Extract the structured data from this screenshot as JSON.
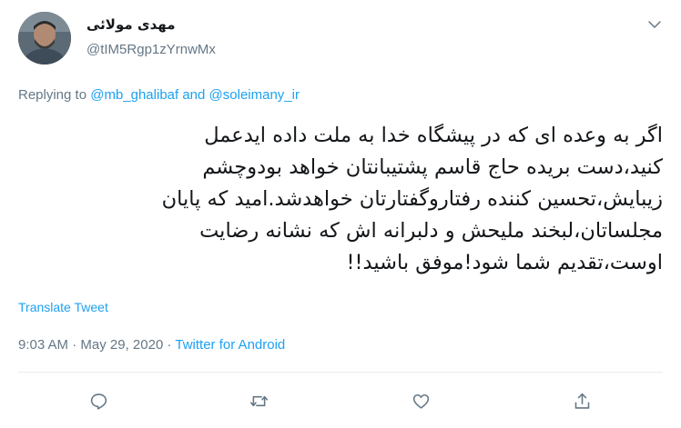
{
  "author": {
    "name": "مهدی مولائی",
    "handle": "@tIM5Rgp1zYrnwMx"
  },
  "reply": {
    "prefix": "Replying to",
    "mention_1": "@mb_ghalibaf",
    "conjunction": "and",
    "mention_2": "@soleimany_ir"
  },
  "tweet": {
    "lines": [
      "اگر به وعده ای که در پیشگاه خدا به ملت داده ایدعمل",
      "کنید،دست بریده حاج قاسم پشتیبانتان خواهد بودوچشم",
      "زیبایش،تحسین کننده رفتاروگفتارتان خواهدشد.امید که پایان",
      "مجلساتان،لبخند ملیحش و دلبرانه اش که نشانه رضایت",
      "اوست،تقدیم شما شود!موفق باشید!!"
    ]
  },
  "translate_label": "Translate Tweet",
  "meta": {
    "time": "9:03 AM",
    "separator_1": "·",
    "date": "May 29, 2020",
    "separator_2": "·",
    "source": "Twitter for Android"
  },
  "icons": {
    "menu": "chevron-down-icon",
    "reply": "reply-icon",
    "retweet": "retweet-icon",
    "like": "heart-icon",
    "share": "share-icon"
  },
  "colors": {
    "link": "#1da1f2",
    "secondary_text": "#657786",
    "primary_text": "#14171a",
    "divider": "#e6ecf0"
  }
}
